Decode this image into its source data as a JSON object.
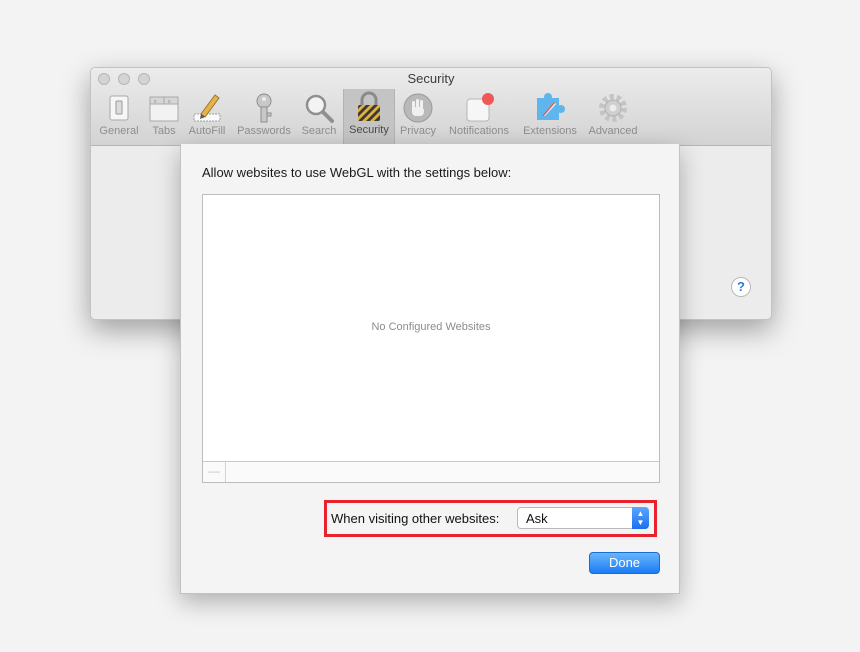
{
  "window": {
    "title": "Security"
  },
  "toolbar": {
    "items": [
      {
        "label": "General",
        "icon": "general-switch-icon"
      },
      {
        "label": "Tabs",
        "icon": "tabs-icon"
      },
      {
        "label": "AutoFill",
        "icon": "autofill-pencil-icon"
      },
      {
        "label": "Passwords",
        "icon": "key-icon"
      },
      {
        "label": "Search",
        "icon": "magnifier-icon"
      },
      {
        "label": "Security",
        "icon": "padlock-icon",
        "selected": true
      },
      {
        "label": "Privacy",
        "icon": "hand-icon"
      },
      {
        "label": "Notifications",
        "icon": "notification-badge-icon"
      },
      {
        "label": "Extensions",
        "icon": "puzzle-piece-icon"
      },
      {
        "label": "Advanced",
        "icon": "gear-icon"
      }
    ]
  },
  "help": {
    "label": "?"
  },
  "sheet": {
    "heading": "Allow websites to use WebGL with the settings below:",
    "list_empty": "No Configured Websites",
    "remove_label": "—",
    "visiting_label": "When visiting other websites:",
    "policy": {
      "value": "Ask"
    },
    "done_label": "Done"
  },
  "colors": {
    "accent": "#1b7cf5",
    "highlight": "#e8232e",
    "badge": "#f25757"
  }
}
